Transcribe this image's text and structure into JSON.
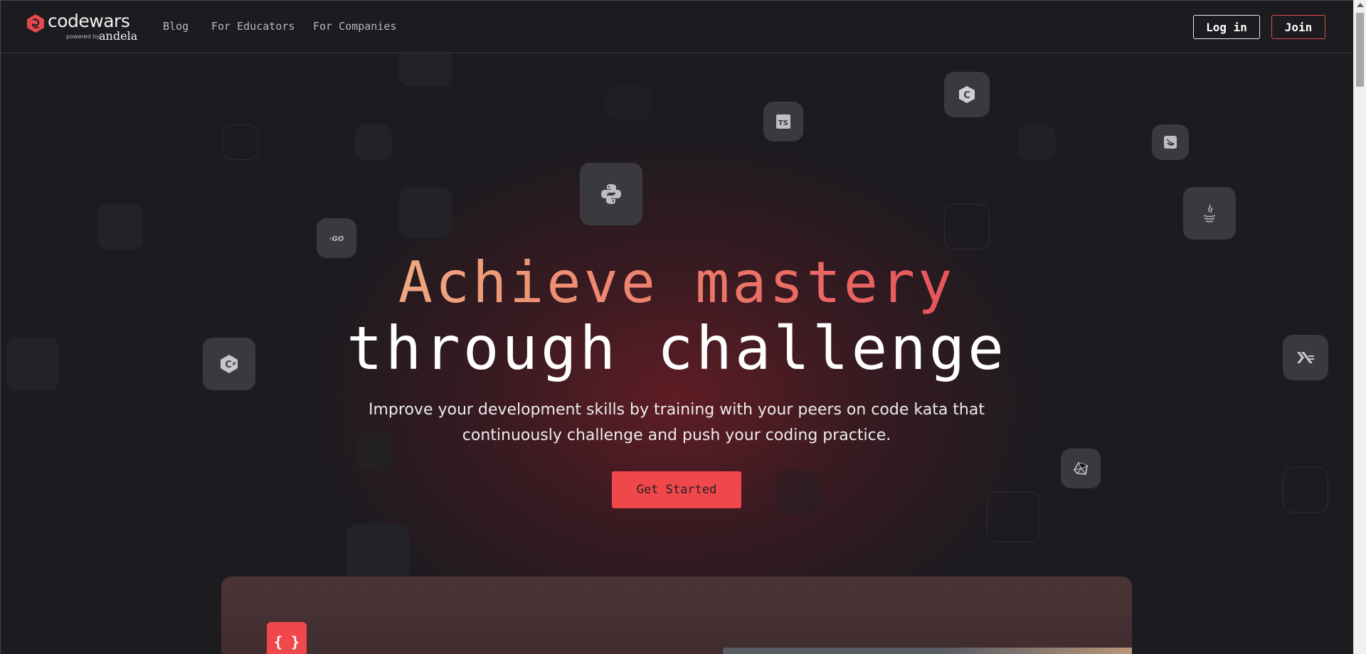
{
  "brand": {
    "name": "codewars",
    "powered_by": "powered by",
    "partner": "andela",
    "accent": "#f0474b"
  },
  "nav": {
    "links": [
      {
        "label": "Blog"
      },
      {
        "label": "For Educators"
      },
      {
        "label": "For Companies"
      }
    ],
    "login_label": "Log in",
    "join_label": "Join"
  },
  "hero": {
    "title_line1": "Achieve mastery",
    "title_line2": "through challenge",
    "subtitle": "Improve your development skills by training with your peers on code kata that continuously challenge and push your coding practice.",
    "cta_label": "Get Started"
  },
  "panel": {
    "badge": "{ }"
  },
  "tiles": [
    {
      "icon": "python-icon"
    },
    {
      "icon": "typescript-icon",
      "text": "TS"
    },
    {
      "icon": "c-icon"
    },
    {
      "icon": "swift-icon"
    },
    {
      "icon": "java-icon"
    },
    {
      "icon": "go-icon",
      "text": "GO"
    },
    {
      "icon": "csharp-icon"
    },
    {
      "icon": "haskell-icon"
    },
    {
      "icon": "crystal-icon"
    }
  ]
}
